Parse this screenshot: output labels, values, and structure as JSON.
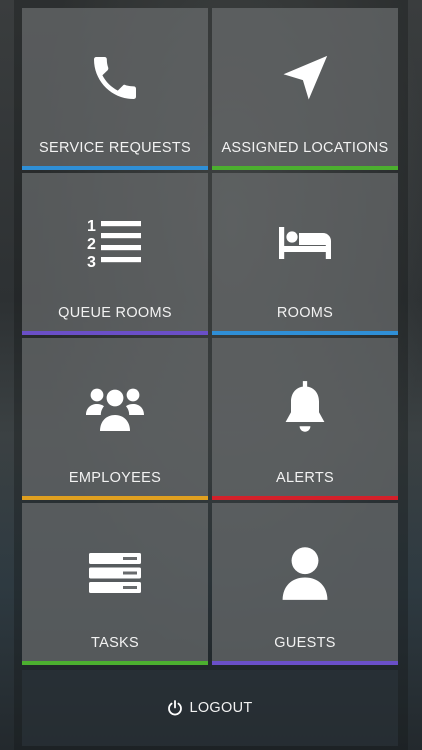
{
  "tiles": [
    {
      "label": "SERVICE REQUESTS",
      "icon": "phone-icon",
      "bar_color": "#2f8fd6"
    },
    {
      "label": "ASSIGNED LOCATIONS",
      "icon": "navigation-arrow-icon",
      "bar_color": "#4caf2f"
    },
    {
      "label": "QUEUE ROOMS",
      "icon": "numbered-list-icon",
      "bar_color": "#6a4fc7"
    },
    {
      "label": "ROOMS",
      "icon": "bed-icon",
      "bar_color": "#2f8fd6"
    },
    {
      "label": "EMPLOYEES",
      "icon": "group-icon",
      "bar_color": "#e0a020"
    },
    {
      "label": "ALERTS",
      "icon": "bell-icon",
      "bar_color": "#d4202a"
    },
    {
      "label": "TASKS",
      "icon": "server-list-icon",
      "bar_color": "#4caf2f"
    },
    {
      "label": "GUESTS",
      "icon": "user-icon",
      "bar_color": "#6a4fc7"
    }
  ],
  "logout": {
    "label": "LOGOUT",
    "icon": "power-icon"
  }
}
